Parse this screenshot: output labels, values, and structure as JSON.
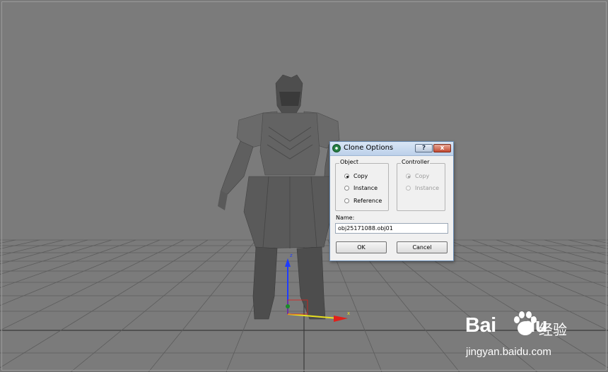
{
  "dialog": {
    "title": "Clone Options",
    "help_glyph": "?",
    "close_glyph": "x",
    "object_group": {
      "legend": "Object",
      "options": [
        {
          "label": "Copy",
          "checked": true
        },
        {
          "label": "Instance",
          "checked": false
        },
        {
          "label": "Reference",
          "checked": false
        }
      ]
    },
    "controller_group": {
      "legend": "Controller",
      "options": [
        {
          "label": "Copy",
          "checked": true,
          "disabled": true
        },
        {
          "label": "Instance",
          "checked": false,
          "disabled": true
        }
      ]
    },
    "name_label": "Name:",
    "name_value": "obj25171088.obj01",
    "ok_label": "OK",
    "cancel_label": "Cancel"
  },
  "gizmo": {
    "z_label": "z",
    "x_label": "x"
  },
  "watermark": {
    "brand": "Bai",
    "brand_suffix": "du",
    "chinese": "经验",
    "url": "jingyan.baidu.com"
  },
  "colors": {
    "viewport_bg": "#7b7b7b",
    "grid_line": "#5c5c5c",
    "axis_z": "#1e3cff",
    "axis_x": "#e0201a",
    "axis_y": "#e8e020"
  }
}
